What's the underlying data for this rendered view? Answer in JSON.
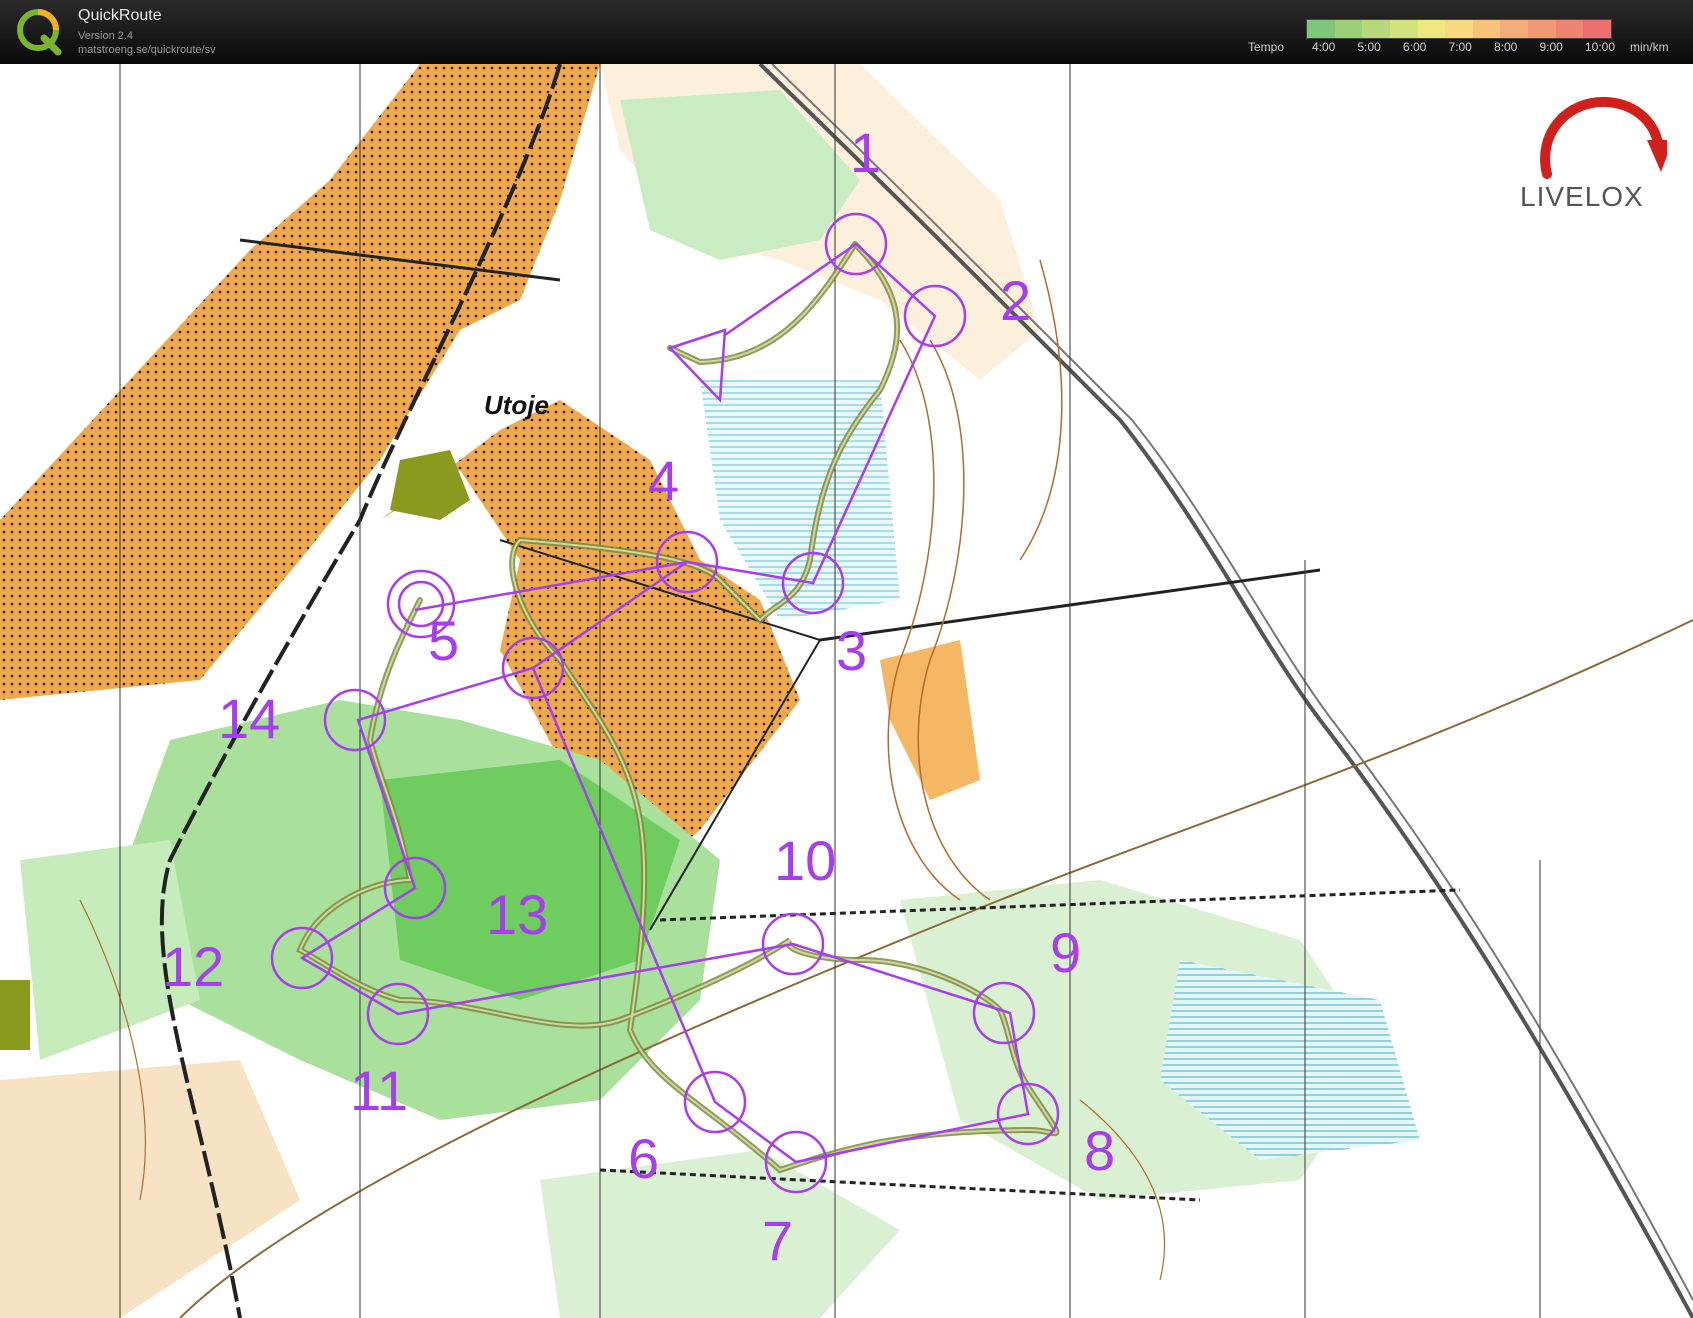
{
  "app": {
    "name": "QuickRoute",
    "version": "Version 2.4",
    "url": "matstroeng.se/quickroute/sv",
    "logo_letter": "Q"
  },
  "tempo": {
    "label": "Tempo",
    "ticks": [
      "4:00",
      "5:00",
      "6:00",
      "7:00",
      "8:00",
      "9:00",
      "10:00"
    ],
    "unit": "min/km",
    "colors": [
      "#7fc77a",
      "#9bd07b",
      "#b7d97c",
      "#d2e27d",
      "#ede97f",
      "#f7d97e",
      "#f6c37b",
      "#f4ad78",
      "#f29875",
      "#f08472",
      "#ee6f6f"
    ]
  },
  "brand": {
    "name": "LIVELOX"
  },
  "map": {
    "place_name": "Utoje",
    "course_color": "#a83cf0",
    "route_color": "#7b8a3a",
    "controls": [
      "1",
      "2",
      "3",
      "4",
      "5",
      "6",
      "7",
      "8",
      "9",
      "10",
      "11",
      "12",
      "13",
      "14"
    ]
  }
}
